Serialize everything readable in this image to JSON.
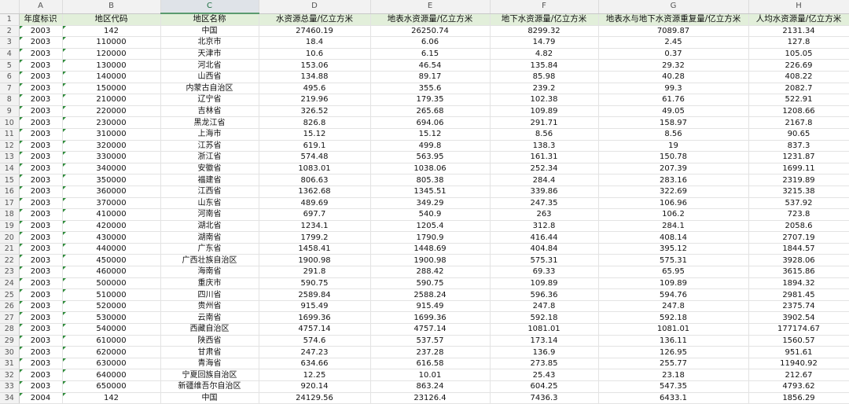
{
  "columns": [
    "A",
    "B",
    "C",
    "D",
    "E",
    "F",
    "G",
    "H"
  ],
  "header_row": {
    "row_number": "1",
    "cells": [
      "年度标识",
      "地区代码",
      "地区名称",
      "水资源总量/亿立方米",
      "地表水资源量/亿立方米",
      "地下水资源量/亿立方米",
      "地表水与地下水资源重复量/亿立方米",
      "人均水资源量/亿立方米"
    ]
  },
  "rows": [
    {
      "n": "2",
      "c": [
        "2003",
        "142",
        "中国",
        "27460.19",
        "26250.74",
        "8299.32",
        "7089.87",
        "2131.34"
      ]
    },
    {
      "n": "3",
      "c": [
        "2003",
        "110000",
        "北京市",
        "18.4",
        "6.06",
        "14.79",
        "2.45",
        "127.8"
      ]
    },
    {
      "n": "4",
      "c": [
        "2003",
        "120000",
        "天津市",
        "10.6",
        "6.15",
        "4.82",
        "0.37",
        "105.05"
      ]
    },
    {
      "n": "5",
      "c": [
        "2003",
        "130000",
        "河北省",
        "153.06",
        "46.54",
        "135.84",
        "29.32",
        "226.69"
      ]
    },
    {
      "n": "6",
      "c": [
        "2003",
        "140000",
        "山西省",
        "134.88",
        "89.17",
        "85.98",
        "40.28",
        "408.22"
      ]
    },
    {
      "n": "7",
      "c": [
        "2003",
        "150000",
        "内蒙古自治区",
        "495.6",
        "355.6",
        "239.2",
        "99.3",
        "2082.7"
      ]
    },
    {
      "n": "8",
      "c": [
        "2003",
        "210000",
        "辽宁省",
        "219.96",
        "179.35",
        "102.38",
        "61.76",
        "522.91"
      ]
    },
    {
      "n": "9",
      "c": [
        "2003",
        "220000",
        "吉林省",
        "326.52",
        "265.68",
        "109.89",
        "49.05",
        "1208.66"
      ]
    },
    {
      "n": "10",
      "c": [
        "2003",
        "230000",
        "黑龙江省",
        "826.8",
        "694.06",
        "291.71",
        "158.97",
        "2167.8"
      ]
    },
    {
      "n": "11",
      "c": [
        "2003",
        "310000",
        "上海市",
        "15.12",
        "15.12",
        "8.56",
        "8.56",
        "90.65"
      ]
    },
    {
      "n": "12",
      "c": [
        "2003",
        "320000",
        "江苏省",
        "619.1",
        "499.8",
        "138.3",
        "19",
        "837.3"
      ]
    },
    {
      "n": "13",
      "c": [
        "2003",
        "330000",
        "浙江省",
        "574.48",
        "563.95",
        "161.31",
        "150.78",
        "1231.87"
      ]
    },
    {
      "n": "14",
      "c": [
        "2003",
        "340000",
        "安徽省",
        "1083.01",
        "1038.06",
        "252.34",
        "207.39",
        "1699.11"
      ]
    },
    {
      "n": "15",
      "c": [
        "2003",
        "350000",
        "福建省",
        "806.63",
        "805.38",
        "284.4",
        "283.16",
        "2319.89"
      ]
    },
    {
      "n": "16",
      "c": [
        "2003",
        "360000",
        "江西省",
        "1362.68",
        "1345.51",
        "339.86",
        "322.69",
        "3215.38"
      ]
    },
    {
      "n": "17",
      "c": [
        "2003",
        "370000",
        "山东省",
        "489.69",
        "349.29",
        "247.35",
        "106.96",
        "537.92"
      ]
    },
    {
      "n": "18",
      "c": [
        "2003",
        "410000",
        "河南省",
        "697.7",
        "540.9",
        "263",
        "106.2",
        "723.8"
      ]
    },
    {
      "n": "19",
      "c": [
        "2003",
        "420000",
        "湖北省",
        "1234.1",
        "1205.4",
        "312.8",
        "284.1",
        "2058.6"
      ]
    },
    {
      "n": "20",
      "c": [
        "2003",
        "430000",
        "湖南省",
        "1799.2",
        "1790.9",
        "416.44",
        "408.14",
        "2707.19"
      ]
    },
    {
      "n": "21",
      "c": [
        "2003",
        "440000",
        "广东省",
        "1458.41",
        "1448.69",
        "404.84",
        "395.12",
        "1844.57"
      ]
    },
    {
      "n": "22",
      "c": [
        "2003",
        "450000",
        "广西壮族自治区",
        "1900.98",
        "1900.98",
        "575.31",
        "575.31",
        "3928.06"
      ]
    },
    {
      "n": "23",
      "c": [
        "2003",
        "460000",
        "海南省",
        "291.8",
        "288.42",
        "69.33",
        "65.95",
        "3615.86"
      ]
    },
    {
      "n": "24",
      "c": [
        "2003",
        "500000",
        "重庆市",
        "590.75",
        "590.75",
        "109.89",
        "109.89",
        "1894.32"
      ]
    },
    {
      "n": "25",
      "c": [
        "2003",
        "510000",
        "四川省",
        "2589.84",
        "2588.24",
        "596.36",
        "594.76",
        "2981.45"
      ]
    },
    {
      "n": "26",
      "c": [
        "2003",
        "520000",
        "贵州省",
        "915.49",
        "915.49",
        "247.8",
        "247.8",
        "2375.74"
      ]
    },
    {
      "n": "27",
      "c": [
        "2003",
        "530000",
        "云南省",
        "1699.36",
        "1699.36",
        "592.18",
        "592.18",
        "3902.54"
      ]
    },
    {
      "n": "28",
      "c": [
        "2003",
        "540000",
        "西藏自治区",
        "4757.14",
        "4757.14",
        "1081.01",
        "1081.01",
        "177174.67"
      ]
    },
    {
      "n": "29",
      "c": [
        "2003",
        "610000",
        "陕西省",
        "574.6",
        "537.57",
        "173.14",
        "136.11",
        "1560.57"
      ]
    },
    {
      "n": "30",
      "c": [
        "2003",
        "620000",
        "甘肃省",
        "247.23",
        "237.28",
        "136.9",
        "126.95",
        "951.61"
      ]
    },
    {
      "n": "31",
      "c": [
        "2003",
        "630000",
        "青海省",
        "634.66",
        "616.58",
        "273.85",
        "255.77",
        "11940.92"
      ]
    },
    {
      "n": "32",
      "c": [
        "2003",
        "640000",
        "宁夏回族自治区",
        "12.25",
        "10.01",
        "25.43",
        "23.18",
        "212.67"
      ]
    },
    {
      "n": "33",
      "c": [
        "2003",
        "650000",
        "新疆维吾尔自治区",
        "920.14",
        "863.24",
        "604.25",
        "547.35",
        "4793.62"
      ]
    },
    {
      "n": "34",
      "c": [
        "2004",
        "142",
        "中国",
        "24129.56",
        "23126.4",
        "7436.3",
        "6433.1",
        "1856.29"
      ]
    }
  ]
}
